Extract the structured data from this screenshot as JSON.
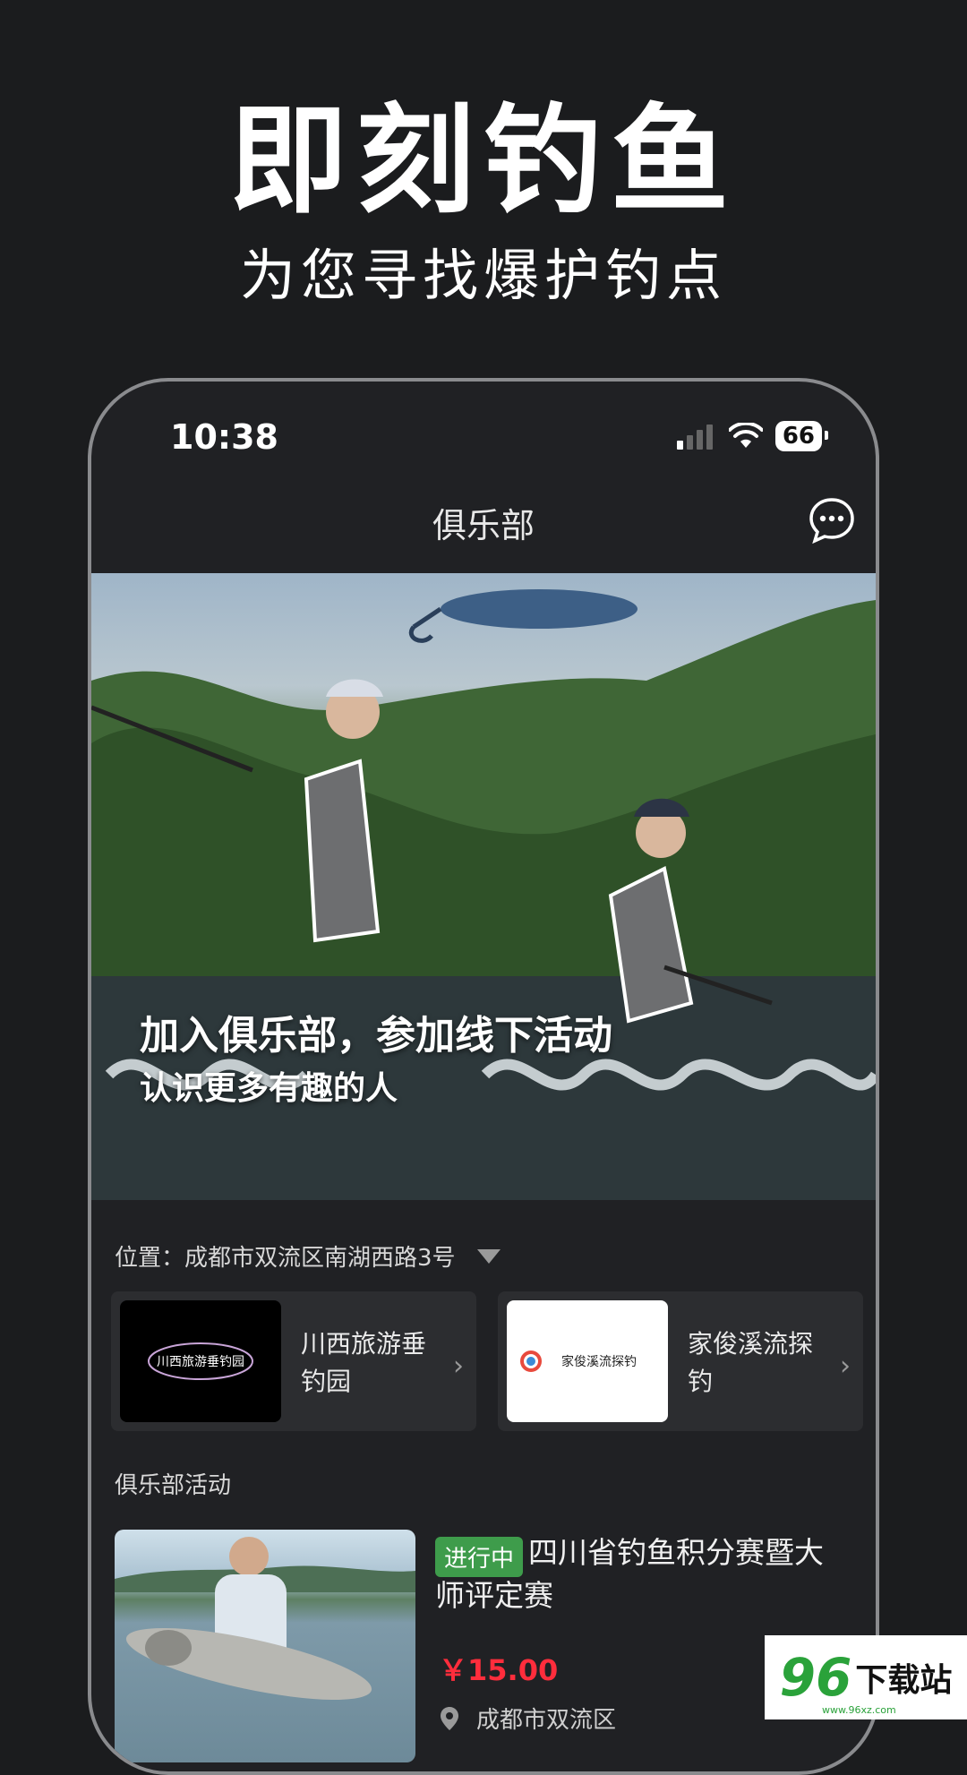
{
  "promo": {
    "title": "即刻钓鱼",
    "subtitle": "为您寻找爆护钓点"
  },
  "status_bar": {
    "time": "10:38",
    "battery": "66"
  },
  "nav": {
    "title": "俱乐部",
    "chat_icon": "chat-bubble-icon"
  },
  "banner": {
    "headline": "加入俱乐部，参加线下活动",
    "subline": "认识更多有趣的人"
  },
  "location": {
    "label": "位置：成都市双流区南湖西路3号"
  },
  "clubs": [
    {
      "name": "川西旅游垂钓园",
      "logo_text": "川西旅游垂钓园",
      "logo_bg": "#000000"
    },
    {
      "name": "家俊溪流探钓",
      "logo_text": "家俊溪流探钓",
      "logo_bg": "#ffffff"
    }
  ],
  "activities_section": {
    "label": "俱乐部活动"
  },
  "activity": {
    "status": "进行中",
    "title": "四川省钓鱼积分赛暨大师评定赛",
    "price": "￥15.00",
    "location": "成都市双流区"
  },
  "watermark": {
    "num": "96",
    "text": "下载站",
    "url": "www.96xz.com"
  },
  "colors": {
    "background": "#1b1c1e",
    "status_green": "#3e9c4b",
    "price_red": "#ff2d3c"
  }
}
